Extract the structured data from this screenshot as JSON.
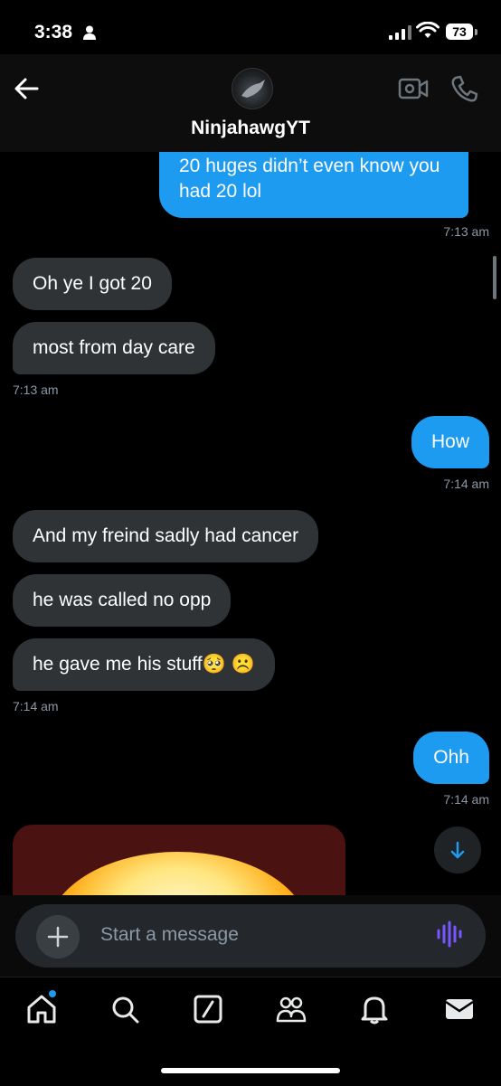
{
  "status": {
    "time": "3:38",
    "battery": "73"
  },
  "header": {
    "contact_name": "NinjahawgYT"
  },
  "messages": [
    {
      "text": "20 huges didn’t even know you",
      "text2": "had 20 lol",
      "time": "7:13 am"
    },
    {
      "text": "Oh ye I got 20"
    },
    {
      "text": "most from day care",
      "time": "7:13 am"
    },
    {
      "text": "How",
      "time": "7:14 am"
    },
    {
      "text": "And my freind sadly had cancer"
    },
    {
      "text": "he was called no opp"
    },
    {
      "text": "he gave me his stuff",
      "emoji": "🥺 ☹️",
      "time": "7:14 am"
    },
    {
      "text": "Ohh",
      "time": "7:14 am"
    }
  ],
  "composer": {
    "placeholder": "Start a message"
  },
  "colors": {
    "accent": "#1d9bf0",
    "incoming": "#2f3336",
    "voice": "#7856ff"
  },
  "tabs": [
    "home-icon",
    "search-icon",
    "grok-icon",
    "communities-icon",
    "notifications-icon",
    "messages-icon"
  ]
}
